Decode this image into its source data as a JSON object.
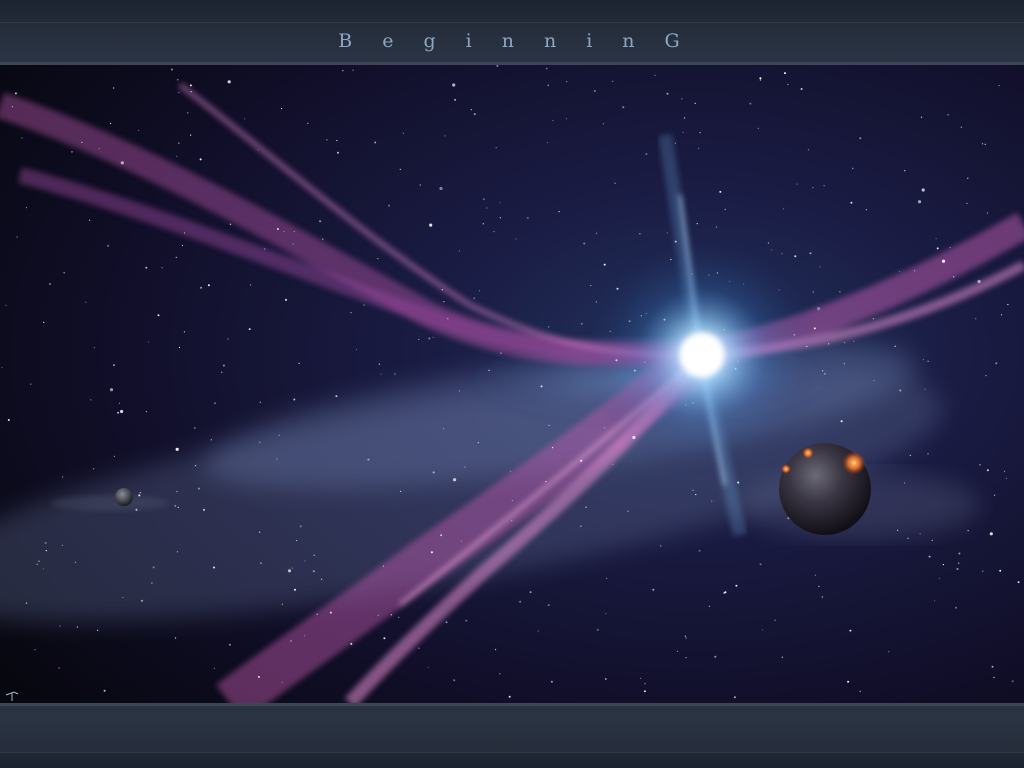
{
  "banner": {
    "title": "BeginninG"
  },
  "colors": {
    "frame": "#1f2633",
    "title": "#8ea6c4",
    "space": "#0b0d1e",
    "nebula": "#c05aa8",
    "star": "#dff4ff"
  }
}
